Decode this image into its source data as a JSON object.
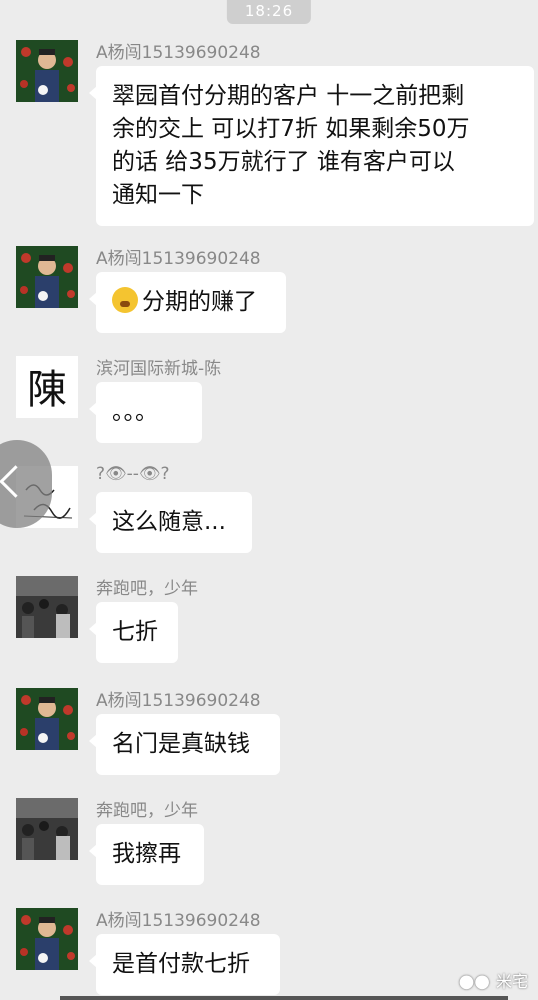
{
  "status_bar": {
    "time": "18:26"
  },
  "messages": [
    {
      "sender": "A杨闯15139690248",
      "avatar": "groom-photo-avatar",
      "lines": [
        "翠园首付分期的客户 十一之前把剩",
        "余的交上  可以打7折  如果剩余50万",
        "的话  给35万就行了    谁有客户可以",
        "通知一下"
      ]
    },
    {
      "sender": "A杨闯15139690248",
      "avatar": "groom-photo-avatar",
      "emoji": "grimace-emoji",
      "text": "分期的赚了"
    },
    {
      "sender": "滨河国际新城-陈",
      "avatar": "calligraphy-chen-avatar",
      "text": "。。。"
    },
    {
      "sender": "?👁--👁?",
      "avatar": "handwriting-avatar",
      "text": "这么随意..."
    },
    {
      "sender": "奔跑吧，少年",
      "avatar": "crowd-bw-avatar",
      "text": "七折"
    },
    {
      "sender": "A杨闯15139690248",
      "avatar": "groom-photo-avatar",
      "text": "名门是真缺钱"
    },
    {
      "sender": "奔跑吧，少年",
      "avatar": "crowd-bw-avatar",
      "text": "我擦再"
    },
    {
      "sender": "A杨闯15139690248",
      "avatar": "groom-photo-avatar",
      "text": "是首付款七折"
    }
  ],
  "watermark": {
    "icon": "wechat-official-icon",
    "text": "米宅"
  },
  "nav": {
    "back_icon": "chevron-left-icon"
  }
}
